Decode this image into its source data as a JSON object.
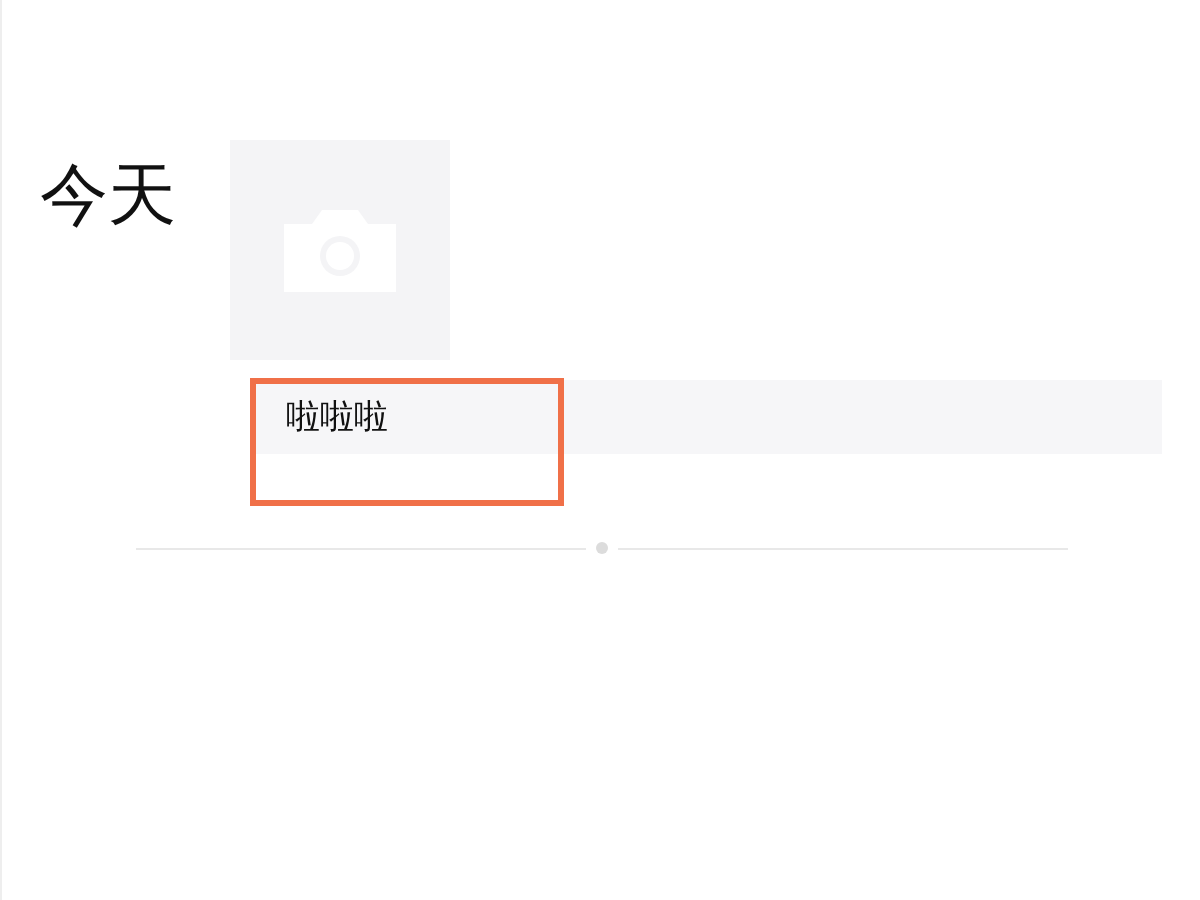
{
  "date_label": "今天",
  "post": {
    "text": "啦啦啦",
    "highlighted": true
  }
}
